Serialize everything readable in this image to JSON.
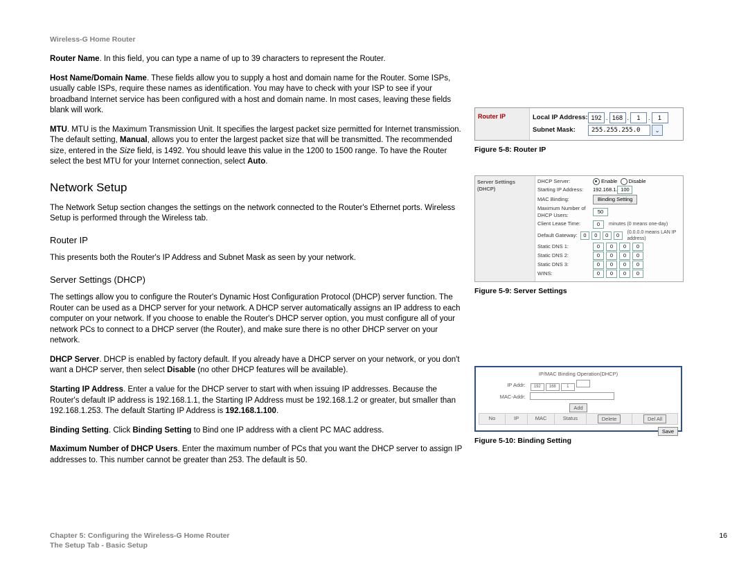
{
  "header": "Wireless-G Home Router",
  "page_number": "16",
  "footer_line1": "Chapter 5: Configuring the Wireless-G Home Router",
  "footer_line2": "The Setup Tab - Basic Setup",
  "paras": {
    "router_name_label": "Router Name",
    "router_name_text": ". In this field, you can type a name of up to 39 characters to represent the Router.",
    "host_label": "Host Name/Domain Name",
    "host_text": ". These fields allow you to supply a host and domain name for the Router. Some ISPs, usually cable ISPs, require these names as identification. You may have to check with your ISP to see if your broadband Internet service has been configured with a host and domain name. In most cases, leaving these fields blank will work.",
    "mtu_label": "MTU",
    "mtu_text1": ". MTU is the Maximum Transmission Unit. It specifies the largest packet size permitted for Internet transmission. The default setting, ",
    "mtu_manual": "Manual",
    "mtu_text2": ", allows you to enter the largest packet size that will be transmitted. The recommended size, entered in the ",
    "mtu_size": "Size",
    "mtu_text3": " field, is 1492. You should leave this value in the 1200 to 1500 range. To have the Router select the best MTU for your Internet connection, select ",
    "mtu_auto": "Auto",
    "mtu_text4": ".",
    "network_setup_h": "Network Setup",
    "network_setup_p": "The Network Setup section changes the settings on the network connected to the Router's Ethernet ports. Wireless Setup is performed through the Wireless tab.",
    "router_ip_h": "Router IP",
    "router_ip_p": "This presents both the Router's IP Address and Subnet Mask as seen by your network.",
    "dhcp_h": "Server Settings (DHCP)",
    "dhcp_p1": "The settings allow you to configure the Router's Dynamic Host Configuration Protocol (DHCP) server function. The Router can be used as a DHCP server for your network. A DHCP server automatically assigns an IP address to each computer on your network. If you choose to enable the Router's DHCP server option, you must configure all of your network PCs to connect to a DHCP server (the Router), and make sure there is no other DHCP server on your network.",
    "dhcp_server_label": "DHCP Server",
    "dhcp_server_text1": ". DHCP is enabled by factory default. If you already have a DHCP server on your network, or you don't want a DHCP server, then select ",
    "dhcp_disable": "Disable",
    "dhcp_server_text2": " (no other DHCP features will be available).",
    "starting_ip_label": "Starting IP Address",
    "starting_ip_text1": ". Enter a value for the DHCP server to start with when issuing IP addresses. Because the Router's default IP address is 192.168.1.1, the Starting IP Address must be 192.168.1.2 or greater, but smaller than 192.168.1.253. The default Starting IP Address is ",
    "starting_ip_default": "192.168.1.100",
    "starting_ip_text2": ".",
    "binding_label": "Binding Setting",
    "binding_text1": ". Click ",
    "binding_bold": "Binding Setting",
    "binding_text2": " to Bind one IP address with a client PC MAC address.",
    "maxusers_label": "Maximum Number of DHCP Users",
    "maxusers_text": ". Enter the maximum number of PCs that you want the DHCP server to assign IP addresses to. This number cannot be greater than 253. The default is 50."
  },
  "fig8": {
    "caption": "Figure 5-8: Router IP",
    "side_label": "Router IP",
    "local_ip_label": "Local IP Address:",
    "subnet_label": "Subnet Mask:",
    "ip": [
      "192",
      "168",
      "1",
      "1"
    ],
    "mask": "255.255.255.0"
  },
  "fig9": {
    "caption": "Figure 5-9: Server Settings",
    "side_label": "Server Settings (DHCP)",
    "rows": {
      "dhcp_server": "DHCP Server:",
      "enable": "Enable",
      "disable": "Disable",
      "starting_ip": "Starting IP Address:",
      "starting_ip_prefix": "192.168.1.",
      "starting_ip_val": "100",
      "mac_binding": "MAC Binding:",
      "binding_btn": "Binding Setting",
      "max_users": "Maximum Number of DHCP Users:",
      "max_users_val": "50",
      "lease": "Client Lease Time:",
      "lease_val": "0",
      "lease_note": "minutes (0 means one-day)",
      "gateway": "Default Gateway:",
      "gateway_note": "(0.0.0.0 means LAN IP address)",
      "dns1": "Static DNS 1:",
      "dns2": "Static DNS 2:",
      "dns3": "Static DNS 3:",
      "wins": "WINS:",
      "zero": "0"
    }
  },
  "fig10": {
    "caption": "Figure 5-10: Binding Setting",
    "title": "IP/MAC Binding Operation(DHCP)",
    "ipaddr": "IP Addr:",
    "ip_prefix": [
      "192",
      "168",
      "1"
    ],
    "macaddr": "MAC-Addr:",
    "add": "Add",
    "cols": [
      "No",
      "IP",
      "MAC",
      "Status",
      "Delete",
      "Del All"
    ],
    "save": "Save"
  }
}
